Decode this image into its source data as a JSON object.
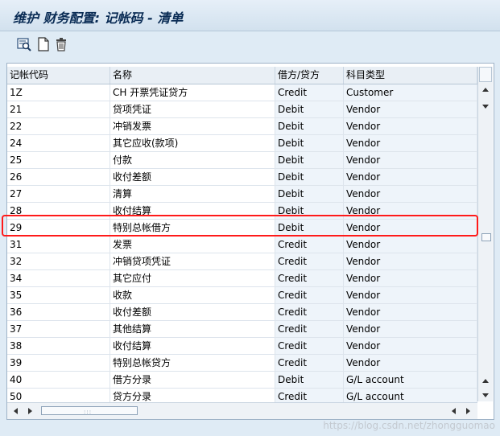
{
  "window": {
    "title": "维护 财务配置: 记帐码 - 清单"
  },
  "toolbar": {
    "buttons": [
      {
        "icon": "details-icon"
      },
      {
        "icon": "new-entry-icon"
      },
      {
        "icon": "delete-icon"
      }
    ]
  },
  "table": {
    "columns": [
      "记帐代码",
      "名称",
      "借方/贷方",
      "科目类型"
    ],
    "rows": [
      [
        "1Z",
        "CH 开票凭证贷方",
        "Credit",
        "Customer"
      ],
      [
        "21",
        "贷项凭证",
        "Debit",
        "Vendor"
      ],
      [
        "22",
        "冲销发票",
        "Debit",
        "Vendor"
      ],
      [
        "24",
        "其它应收(款项)",
        "Debit",
        "Vendor"
      ],
      [
        "25",
        "付款",
        "Debit",
        "Vendor"
      ],
      [
        "26",
        "收付差额",
        "Debit",
        "Vendor"
      ],
      [
        "27",
        "清算",
        "Debit",
        "Vendor"
      ],
      [
        "28",
        "收付结算",
        "Debit",
        "Vendor"
      ],
      [
        "29",
        "特别总帐借方",
        "Debit",
        "Vendor"
      ],
      [
        "31",
        "发票",
        "Credit",
        "Vendor"
      ],
      [
        "32",
        "冲销贷项凭证",
        "Credit",
        "Vendor"
      ],
      [
        "34",
        "其它应付",
        "Credit",
        "Vendor"
      ],
      [
        "35",
        "收款",
        "Credit",
        "Vendor"
      ],
      [
        "36",
        "收付差额",
        "Credit",
        "Vendor"
      ],
      [
        "37",
        "其他结算",
        "Credit",
        "Vendor"
      ],
      [
        "38",
        "收付结算",
        "Credit",
        "Vendor"
      ],
      [
        "39",
        "特别总帐贷方",
        "Credit",
        "Vendor"
      ],
      [
        "40",
        "借方分录",
        "Debit",
        "G/L account"
      ],
      [
        "50",
        "贷方分录",
        "Credit",
        "G/L account"
      ]
    ],
    "highlighted_row": "29"
  },
  "watermark": "https://blog.csdn.net/zhongguomao",
  "colors": {
    "background": "#dfebf5",
    "title": "#0a2c55",
    "highlight_border": "#ff1a1a",
    "column_tint": "#eef4fa"
  }
}
